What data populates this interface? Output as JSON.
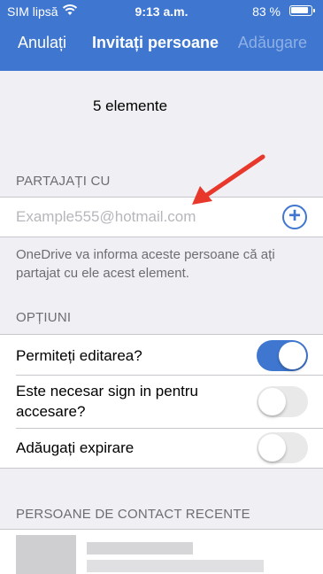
{
  "status_bar": {
    "carrier": "SIM lipsă",
    "time": "9:13 a.m.",
    "battery": "83 %"
  },
  "nav": {
    "cancel": "Anulați",
    "title": "Invitați persoane",
    "add": "Adăugare"
  },
  "item_count": "5 elemente",
  "share_section": {
    "label": "PARTAJAȚI CU",
    "placeholder": "Example555@hotmail.com"
  },
  "note": "OneDrive va informa aceste persoane că ați partajat cu ele acest element.",
  "options": {
    "label": "OPȚIUNI",
    "items": [
      {
        "label": "Permiteți editarea?",
        "enabled": true
      },
      {
        "label": "Este necesar sign in pentru accesare?",
        "enabled": false
      },
      {
        "label": "Adăugați expirare",
        "enabled": false
      }
    ]
  },
  "recent": {
    "label": "PERSOANE DE CONTACT RECENTE"
  },
  "colors": {
    "accent": "#3f76cf",
    "arrow": "#e8382b"
  }
}
